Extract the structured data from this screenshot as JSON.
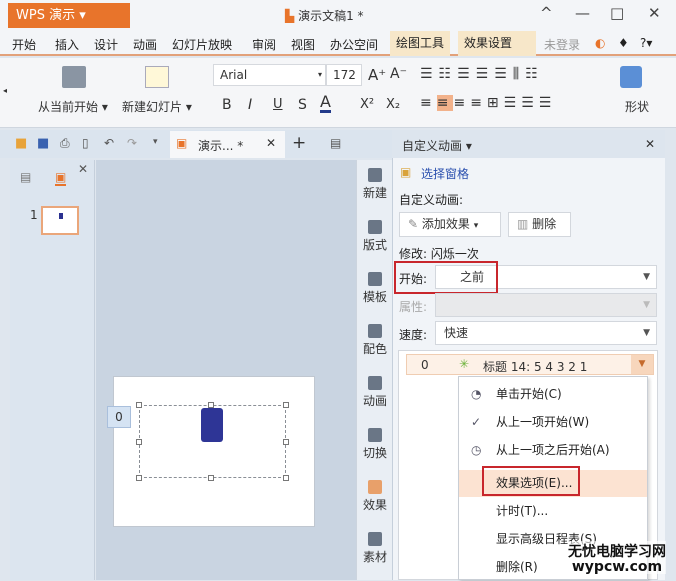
{
  "app": {
    "menu_button": "WPS 演示",
    "doc_title": "演示文稿1 *"
  },
  "window": {
    "minimize": "—",
    "maximize": "□",
    "close": "✕",
    "ribbon_collapse": "^"
  },
  "menu": [
    "开始",
    "插入",
    "设计",
    "动画",
    "幻灯片放映",
    "审阅",
    "视图",
    "办公空间",
    "绘图工具",
    "效果设置"
  ],
  "menu_right": {
    "login": "未登录",
    "help": "?"
  },
  "toolbar": {
    "play_from_current": "从当前开始",
    "new_slide": "新建幻灯片",
    "font_name": "Arial",
    "font_size": "172",
    "grow": "A⁺",
    "shrink": "A⁻",
    "bold": "B",
    "italic": "I",
    "underline": "U",
    "strike": "S",
    "font_color": "A",
    "superscript": "X²",
    "subscript": "X₂",
    "shape": "形状"
  },
  "doc_tab": {
    "label": "演示... *",
    "close": "✕",
    "add": "+"
  },
  "slides": {
    "number": "1"
  },
  "slide": {
    "anim_tag": "0"
  },
  "vtools": [
    "新建",
    "版式",
    "模板",
    "配色",
    "动画",
    "切换",
    "效果",
    "素材"
  ],
  "pane": {
    "title": "自定义动画 ▾",
    "close": "✕",
    "select_pane": "选择窗格",
    "section": "自定义动画:",
    "add_effect": "添加效果",
    "delete": "删除",
    "modify": "修改: 闪烁一次",
    "start_label": "开始:",
    "start_value": "之前",
    "property_label": "属性:",
    "speed_label": "速度:",
    "speed_value": "快速",
    "item": {
      "index": "0",
      "name": "标题 14: 5 4 3 2 1"
    }
  },
  "context_menu": [
    "单击开始(C)",
    "从上一项开始(W)",
    "从上一项之后开始(A)",
    "效果选项(E)...",
    "计时(T)...",
    "显示高级日程表(S)",
    "删除(R)"
  ],
  "watermark": {
    "line1": "无忧电脑学习网",
    "line2": "wypcw.com"
  },
  "colors": {
    "accent": "#e8742b",
    "highlight": "#c8262c",
    "menu_hover": "#fce3d2"
  }
}
